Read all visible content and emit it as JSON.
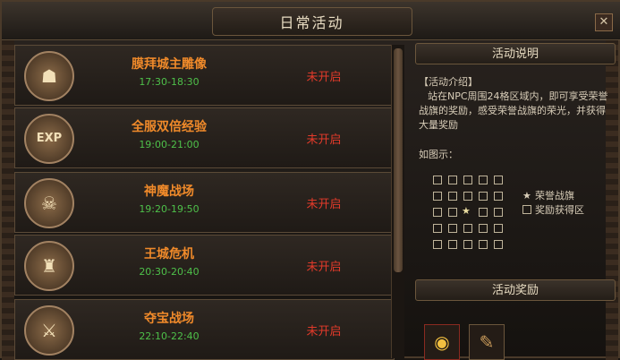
{
  "window": {
    "title": "日常活动",
    "close_glyph": "✕"
  },
  "activities": [
    {
      "name": "膜拜城主雕像",
      "time": "17:30-18:30",
      "status": "未开启",
      "icon_name": "statue-icon",
      "icon_glyph": "☗"
    },
    {
      "name": "全服双倍经验",
      "time": "19:00-21:00",
      "status": "未开启",
      "icon_name": "exp-icon",
      "icon_glyph": "EXP"
    },
    {
      "name": "神魔战场",
      "time": "19:20-19:50",
      "status": "未开启",
      "icon_name": "demon-battlefield-icon",
      "icon_glyph": "☠"
    },
    {
      "name": "王城危机",
      "time": "20:30-20:40",
      "status": "未开启",
      "icon_name": "castle-crisis-icon",
      "icon_glyph": "♜"
    },
    {
      "name": "夺宝战场",
      "time": "22:10-22:40",
      "status": "未开启",
      "icon_name": "crossed-swords-icon",
      "icon_glyph": "⚔"
    }
  ],
  "info": {
    "header": "活动说明",
    "intro_heading": "【活动介绍】",
    "intro_body": "站在NPC周围24格区域内，即可享受荣誉战旗的奖励，感受荣誉战旗的荣光，并获得大量奖励",
    "diagram_label": "如图示：",
    "legend": [
      {
        "symbol": "★",
        "label": "荣誉战旗"
      },
      {
        "symbol": "□",
        "label": "奖励获得区"
      }
    ],
    "rewards_header": "活动奖励"
  },
  "rewards": [
    {
      "name": "gold-ingot-icon",
      "glyph": "◉"
    },
    {
      "name": "scroll-icon",
      "glyph": "✎"
    }
  ],
  "colors": {
    "activity_name": "#f08a2a",
    "activity_time": "#4ec04a",
    "status_closed": "#e23a2a"
  }
}
